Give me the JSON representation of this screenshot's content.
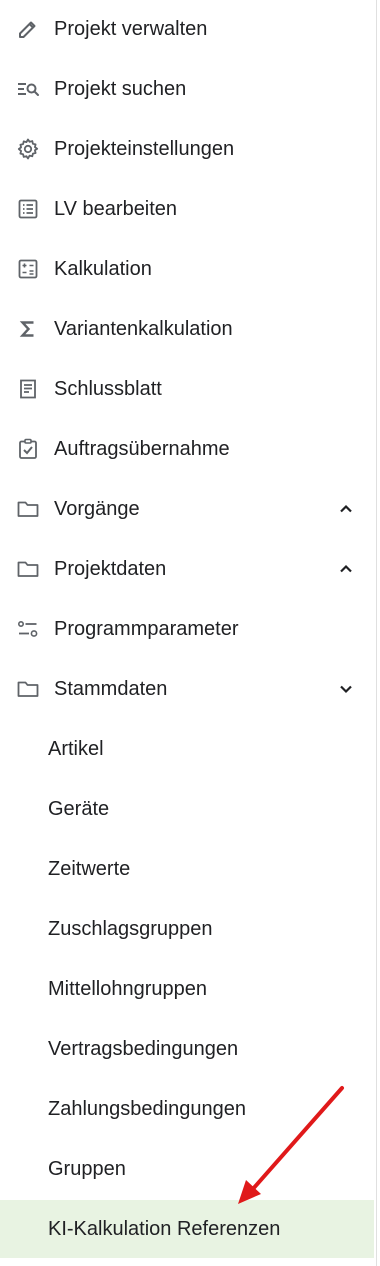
{
  "menu": {
    "items": [
      {
        "label": "Projekt verwalten",
        "icon": "pencil-icon"
      },
      {
        "label": "Projekt suchen",
        "icon": "search-list-icon"
      },
      {
        "label": "Projekteinstellungen",
        "icon": "gear-icon"
      },
      {
        "label": "LV bearbeiten",
        "icon": "list-icon"
      },
      {
        "label": "Kalkulation",
        "icon": "calculator-icon"
      },
      {
        "label": "Variantenkalkulation",
        "icon": "sigma-icon"
      },
      {
        "label": "Schlussblatt",
        "icon": "receipt-icon"
      },
      {
        "label": "Auftragsübernahme",
        "icon": "clipboard-check-icon"
      },
      {
        "label": "Vorgänge",
        "icon": "folder-icon",
        "chevron": "chevron-up-icon"
      },
      {
        "label": "Projektdaten",
        "icon": "folder-icon",
        "chevron": "chevron-up-icon"
      },
      {
        "label": "Programmparameter",
        "icon": "sliders-icon"
      },
      {
        "label": "Stammdaten",
        "icon": "folder-icon",
        "chevron": "chevron-down-icon"
      }
    ],
    "subitems": [
      {
        "label": "Artikel"
      },
      {
        "label": "Geräte"
      },
      {
        "label": "Zeitwerte"
      },
      {
        "label": "Zuschlagsgruppen"
      },
      {
        "label": "Mittellohngruppen"
      },
      {
        "label": "Vertragsbedingungen"
      },
      {
        "label": "Zahlungsbedingungen"
      },
      {
        "label": "Gruppen"
      },
      {
        "label": "KI-Kalkulation Referenzen"
      }
    ]
  },
  "colors": {
    "text": "#202124",
    "icon": "#5f6368",
    "active_bg": "#e8f3e2",
    "annotation_arrow": "#e0191a"
  }
}
